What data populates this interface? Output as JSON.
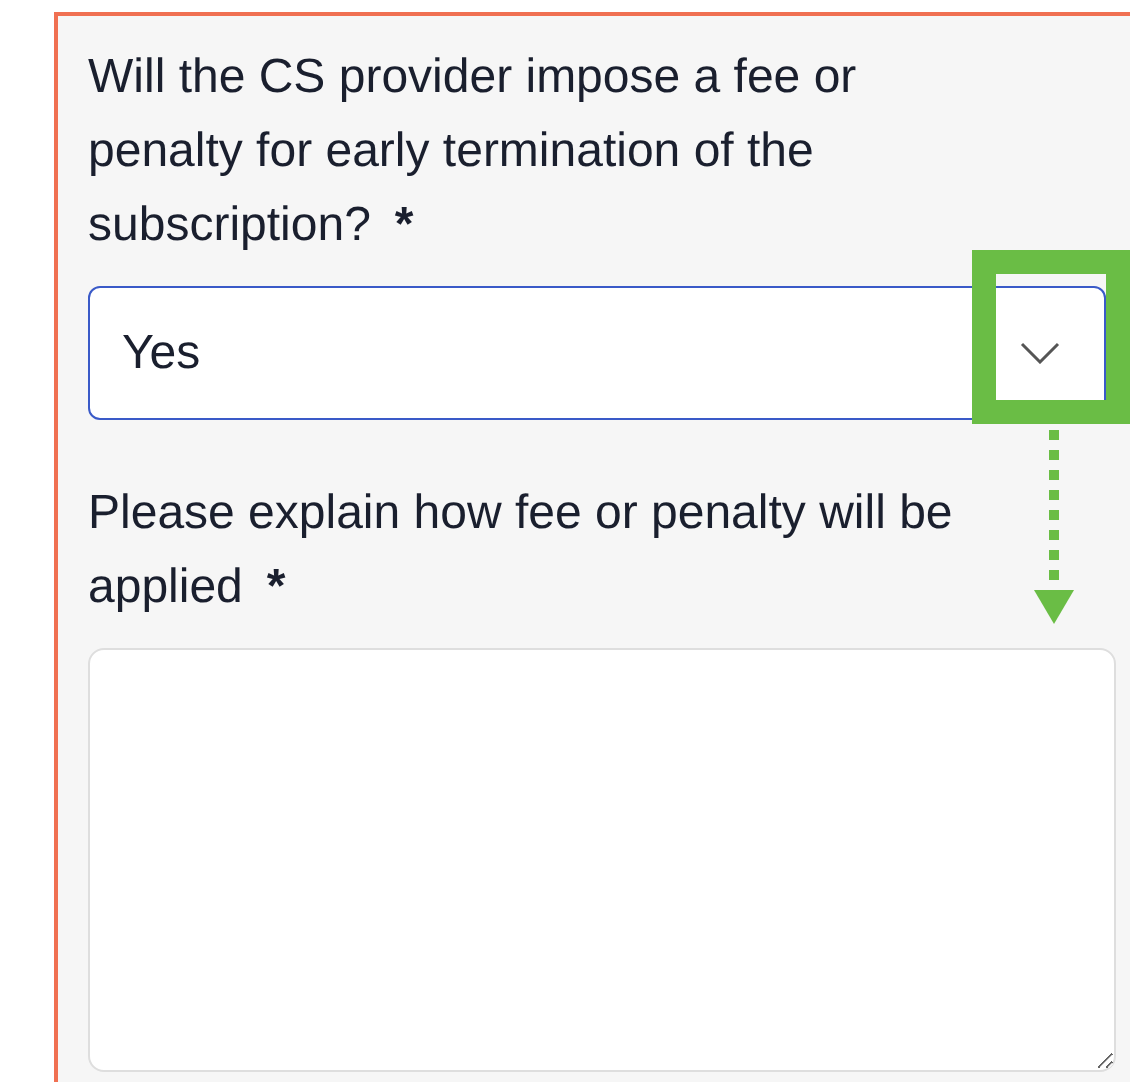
{
  "questions": [
    {
      "kind": "select",
      "label": "Will the CS provider impose a fee or penalty for early termination of the subscription?",
      "required_mark": "*",
      "value": "Yes"
    },
    {
      "kind": "textarea",
      "label": "Please explain how fee or penalty will be applied",
      "required_mark": "*"
    }
  ]
}
